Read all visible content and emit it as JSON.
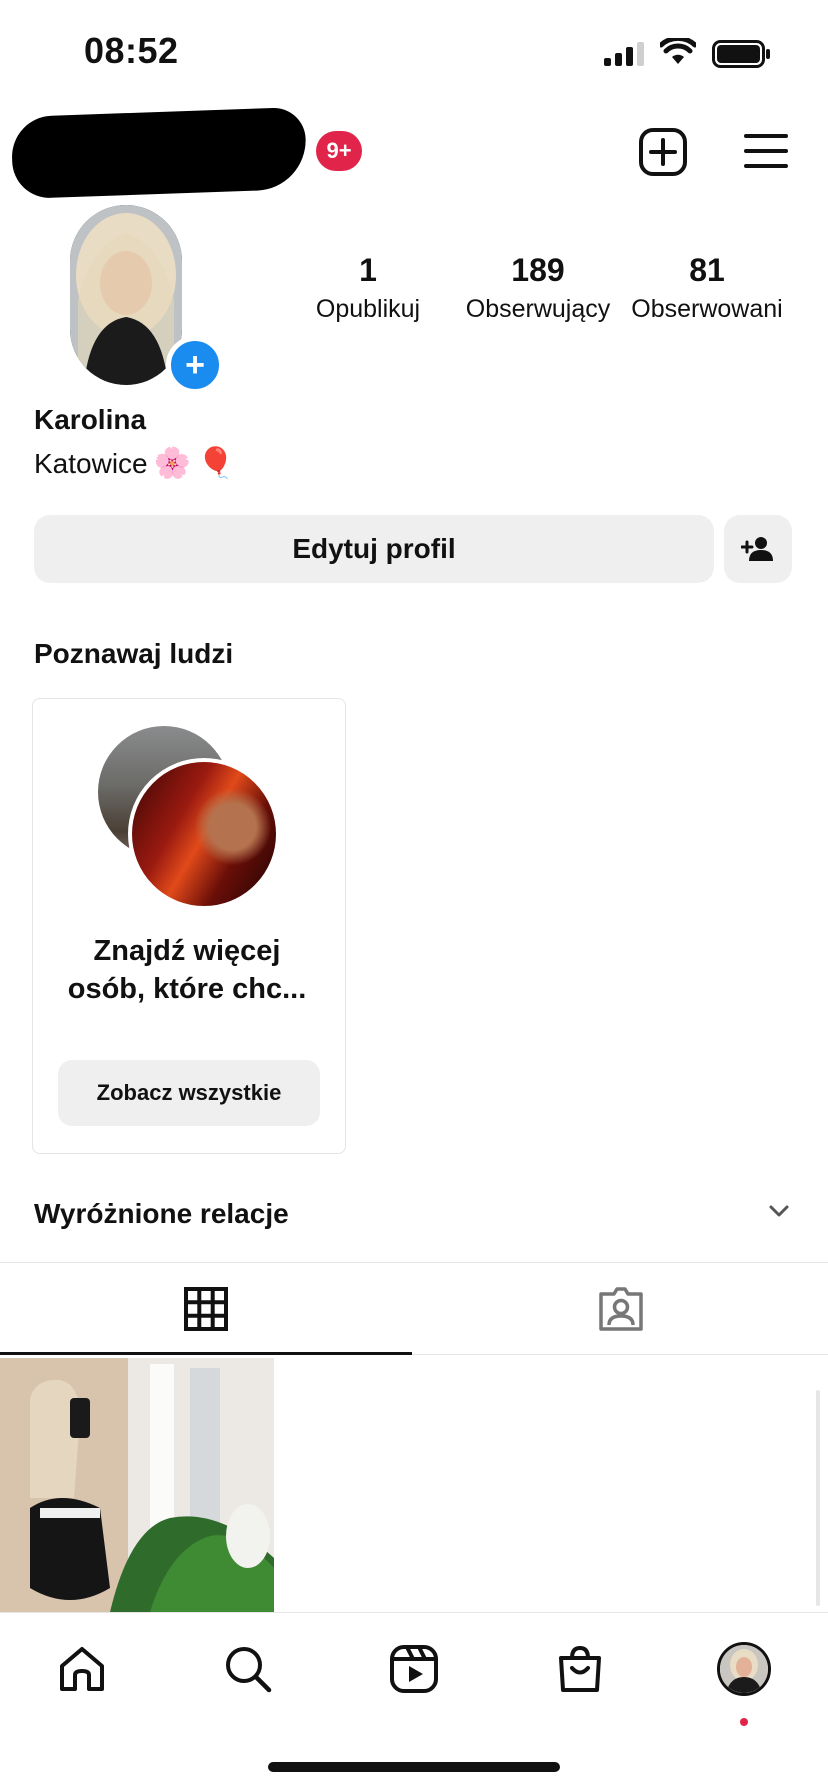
{
  "status_bar": {
    "time": "08:52",
    "signal_icon": "cellular-signal-icon",
    "wifi_icon": "wifi-icon",
    "battery_icon": "battery-icon"
  },
  "header": {
    "notification_badge": "9+",
    "new_post_icon": "plus-square-icon",
    "menu_icon": "hamburger-menu-icon"
  },
  "profile": {
    "stats": [
      {
        "value": "1",
        "label": "Opublikuj"
      },
      {
        "value": "189",
        "label": "Obserwujący"
      },
      {
        "value": "81",
        "label": "Obserwowani"
      }
    ],
    "name": "Karolina",
    "bio_text": "Katowice",
    "bio_emojis": [
      "🌸",
      "🎈"
    ],
    "add_story_symbol": "+"
  },
  "actions": {
    "edit_profile": "Edytuj profil",
    "discover_people_icon": "add-person-icon"
  },
  "suggestions": {
    "title": "Poznawaj ludzi",
    "card_text": "Znajdź więcej osób, które chc...",
    "card_button": "Zobacz wszystkie"
  },
  "highlights": {
    "title": "Wyróżnione relacje",
    "toggle_icon": "chevron-down-icon"
  },
  "tabs": [
    {
      "icon": "grid-icon",
      "active": true
    },
    {
      "icon": "tagged-user-icon",
      "active": false
    }
  ],
  "bottom_nav": [
    {
      "icon": "home-icon"
    },
    {
      "icon": "search-icon"
    },
    {
      "icon": "reels-icon"
    },
    {
      "icon": "shop-icon"
    },
    {
      "icon": "profile-avatar"
    }
  ],
  "colors": {
    "badge": "#e0244a",
    "add_story": "#1a8cf0",
    "button_bg": "#efefef"
  }
}
